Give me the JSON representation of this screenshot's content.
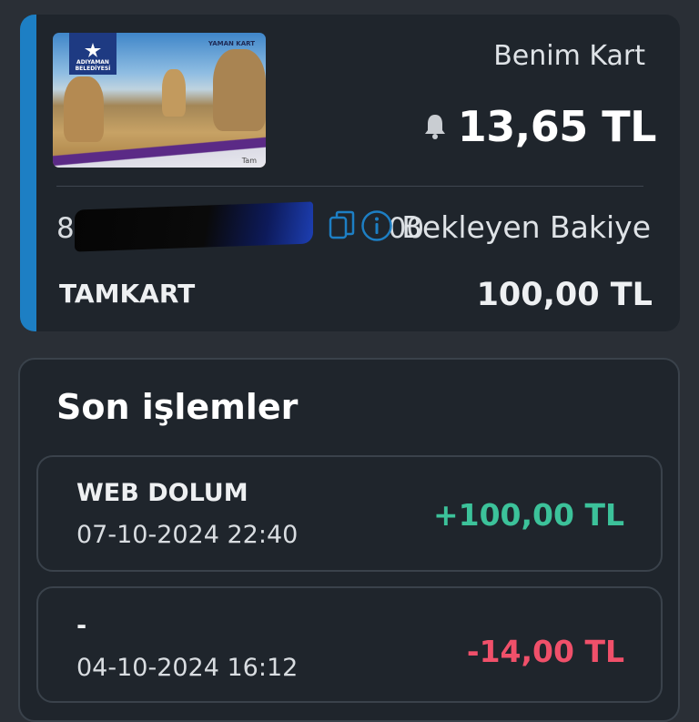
{
  "colors": {
    "background": "#2a2f36",
    "panel": "#1f252c",
    "accent": "#1d7fc4",
    "positive": "#3cc29a",
    "negative": "#f0506a"
  },
  "card": {
    "image": {
      "logo_text_line1": "ADIYAMAN",
      "logo_text_line2": "BELEDİYESİ",
      "brand_text": "YAMAN KART",
      "type_text": "Tam"
    },
    "name": "Benim Kart",
    "balance_icon": "bell-icon",
    "balance": "13,65 TL",
    "number": "8                                   00",
    "copy_icon": "copy-icon",
    "info_icon": "info-icon",
    "pending_label": "Bekleyen Bakiye",
    "type": "TAMKART",
    "pending_amount": "100,00 TL"
  },
  "transactions": {
    "title": "Son işlemler",
    "items": [
      {
        "description": "WEB DOLUM",
        "date": "07-10-2024 22:40",
        "amount": "+100,00 TL"
      },
      {
        "description": "-",
        "date": "04-10-2024 16:12",
        "amount": "-14,00 TL"
      }
    ]
  }
}
